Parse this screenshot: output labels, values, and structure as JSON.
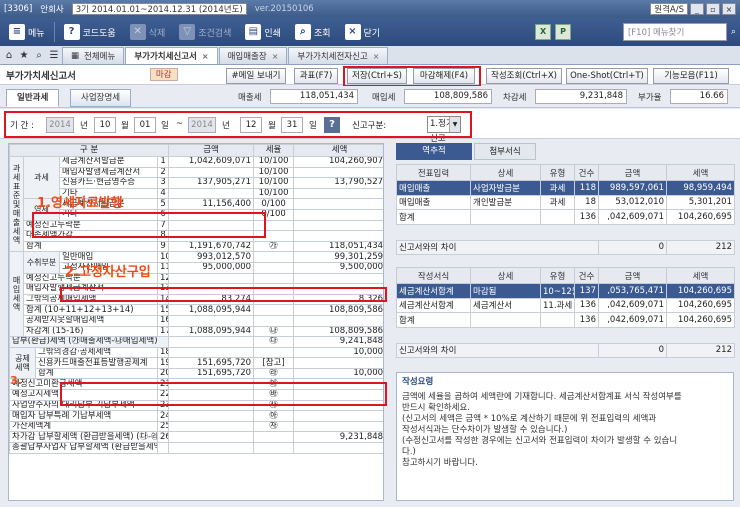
{
  "titlebar": {
    "code": "[3306]",
    "company": "안회사",
    "period": "3기 2014.01.01~2014.12.31 (2014년도)",
    "version": "ver.20150106",
    "service": "원격A/S"
  },
  "toolbar": {
    "menu": "메뉴",
    "codehelp": "코드도움",
    "delete": "삭제",
    "condsearch": "조건검색",
    "print": "인쇄",
    "search": "조회",
    "close": "닫기",
    "search_placeholder": "[F10] 메뉴찾기",
    "excel": "X",
    "pdf": "P"
  },
  "tabs": [
    "전체메뉴",
    "부가가치세신고서",
    "매입매출장",
    "부가가치세전자신고"
  ],
  "header": {
    "title": "부가가치세신고서",
    "status": "마감",
    "btn_email": "#메일 보내기",
    "btn_tax": "과표(F7)",
    "btn_save": "저장(Ctrl+S)",
    "btn_unclose": "마감해제(F4)",
    "btn_create": "작성조회(Ctrl+X)",
    "btn_oneshot": "One-Shot(Ctrl+T)",
    "btn_func": "기능모음(F11)"
  },
  "subtabs": [
    "일반과세",
    "사업장명세"
  ],
  "summary": {
    "sales_label": "매출세",
    "sales": "118,051,434",
    "purchase_label": "매입세",
    "purchase": "108,809,586",
    "payable_label": "차감세",
    "payable": "9,231,848",
    "rate_label": "부가율",
    "rate": "16.66"
  },
  "period": {
    "label": "기 간 :",
    "from_year": "2014",
    "y": "년",
    "from_month": "10",
    "m": "월",
    "from_day": "01",
    "d": "일",
    "tilde": "~",
    "to_year": "2014",
    "to_month": "12",
    "to_day": "31",
    "type_label": "신고구분:",
    "type_value": "1.정기신고"
  },
  "left": {
    "hdr_item": "구 분",
    "hdr_amount": "금액",
    "hdr_rate": "세율",
    "hdr_tax": "세액",
    "sec_sales": "과세표준및매출세액",
    "sec_purchase": "매입세액",
    "sec_pay": "납부(환급)세액",
    "sec_deduct": "공제세액",
    "g_tax": "과세",
    "g_zero": "영세",
    "g_purch": "수취부분",
    "rows": [
      {
        "label": "세금계산서발급분",
        "no": "1",
        "amount": "1,042,609,071",
        "rate": "10/100",
        "tax": "104,260,907"
      },
      {
        "label": "매입자발행세금계산서",
        "no": "2",
        "amount": "",
        "rate": "10/100",
        "tax": ""
      },
      {
        "label": "신용카드·현금영수증",
        "no": "3",
        "amount": "137,905,271",
        "rate": "10/100",
        "tax": "13,790,527"
      },
      {
        "label": "기타",
        "no": "4",
        "amount": "",
        "rate": "10/100",
        "tax": ""
      },
      {
        "label": "세금계산서발급분",
        "no": "5",
        "amount": "11,156,400",
        "rate": "0/100",
        "tax": ""
      },
      {
        "label": "기타",
        "no": "6",
        "amount": "",
        "rate": "0/100",
        "tax": ""
      },
      {
        "label": "예정신고누락분",
        "no": "7",
        "amount": "",
        "rate": "",
        "tax": ""
      },
      {
        "label": "대손세액가감",
        "no": "8",
        "amount": "",
        "rate": "",
        "tax": ""
      },
      {
        "label": "합계",
        "no": "9",
        "amount": "1,191,670,742",
        "rate": "㉮",
        "tax": "118,051,434"
      },
      {
        "label": "일반매입",
        "no": "10",
        "amount": "993,012,570",
        "rate": "",
        "tax": "99,301,259"
      },
      {
        "label": "고정자산매입",
        "no": "11",
        "amount": "95,000,000",
        "rate": "",
        "tax": "9,500,000"
      },
      {
        "label": "예정신고누락분",
        "no": "12",
        "amount": "",
        "rate": "",
        "tax": ""
      },
      {
        "label": "매입자발행세금계산서",
        "no": "13",
        "amount": "",
        "rate": "",
        "tax": ""
      },
      {
        "label": "그밖의공제매입세액",
        "no": "14",
        "amount": "83,274",
        "rate": "",
        "tax": "8,326"
      },
      {
        "label": "합계 (10+11+12+13+14)",
        "no": "15",
        "amount": "1,088,095,944",
        "rate": "",
        "tax": "108,809,586"
      },
      {
        "label": "공제받지못할매입세액",
        "no": "16",
        "amount": "",
        "rate": "",
        "tax": ""
      },
      {
        "label": "차감계 (15-16)",
        "no": "17",
        "amount": "1,088,095,944",
        "rate": "㉯",
        "tax": "108,809,586"
      },
      {
        "label": "납부(환급)세액 (㉮매출세액-㉯매입세액)",
        "no": "",
        "amount": "",
        "rate": "㉰",
        "tax": "9,241,848"
      },
      {
        "label": "그밖의경감·공제세액",
        "no": "18",
        "amount": "",
        "rate": "",
        "tax": "10,000"
      },
      {
        "label": "신용카드매출전표등발행공제계",
        "no": "19",
        "amount": "151,695,720",
        "rate": "[참고]",
        "tax": ""
      },
      {
        "label": "합계",
        "no": "20",
        "amount": "151,695,720",
        "rate": "㉱",
        "tax": "10,000"
      },
      {
        "label": "예정신고미환급세액",
        "no": "21",
        "amount": "",
        "rate": "㉲",
        "tax": ""
      },
      {
        "label": "예정고지세액",
        "no": "22",
        "amount": "",
        "rate": "㉳",
        "tax": ""
      },
      {
        "label": "사업양수자의 대리납부 기납부세액",
        "no": "23",
        "amount": "",
        "rate": "㉴",
        "tax": ""
      },
      {
        "label": "매입자 납부특례 기납부세액",
        "no": "24",
        "amount": "",
        "rate": "㉵",
        "tax": ""
      },
      {
        "label": "가산세액계",
        "no": "25",
        "amount": "",
        "rate": "㉶",
        "tax": ""
      },
      {
        "label": "차가감 납부할세액 (환급받을세액) (㉰-㉱-㉲-㉳-㉴-㉵+㉶)",
        "no": "26",
        "amount": "",
        "rate": "",
        "tax": "9,231,848"
      },
      {
        "label": "총괄납부사업자 납부할세액 (환급받을세액)",
        "no": "",
        "amount": "",
        "rate": "",
        "tax": ""
      }
    ],
    "anno1": "1.영세자료발행",
    "anno2": "2.고정자산구입",
    "anno3": "3."
  },
  "right": {
    "tab_active": "역추적",
    "tab_other": "첨부서식",
    "t1_headers": [
      "전표입력",
      "상세",
      "유형",
      "건수",
      "금액",
      "세액"
    ],
    "t1_rows": [
      {
        "c0": "매입매출",
        "c1": "사업자발급분",
        "c2": "과세",
        "c3": "118",
        "c4": "989,597,061",
        "c5": "98,959,494"
      },
      {
        "c0": "매입매출",
        "c1": "개인발급분",
        "c2": "과세",
        "c3": "18",
        "c4": "53,012,010",
        "c5": "5,301,201"
      },
      {
        "c0": "합계",
        "c1": "",
        "c2": "",
        "c3": "136",
        "c4": ",042,609,071",
        "c5": "104,260,695"
      }
    ],
    "t1_diff_label": "신고서와의 차이",
    "t1_diff_amount": "0",
    "t1_diff_tax": "212",
    "t2_headers": [
      "작성서식",
      "상세",
      "유형",
      "건수",
      "금액",
      "세액"
    ],
    "t2_rows": [
      {
        "c0": "세금계산서합계",
        "c1": "마감됨",
        "c2": "10~12월",
        "c3": "137",
        "c4": ",053,765,471",
        "c5": "104,260,695"
      },
      {
        "c0": "세금계산서합계",
        "c1": "세금계산서",
        "c2": "11.과세",
        "c3": "136",
        "c4": ",042,609,071",
        "c5": "104,260,695"
      },
      {
        "c0": "합계",
        "c1": "",
        "c2": "",
        "c3": "136",
        "c4": ",042,609,071",
        "c5": "104,260,695"
      }
    ],
    "t2_diff_label": "신고서와의 차이",
    "t2_diff_amount": "0",
    "t2_diff_tax": "212",
    "note_title": "작성요령",
    "note_lines": [
      "금액에 세율을 곱하여 세액란에 기재합니다. 세금계산서합계표 서식 작성여부를",
      "반드시 확인하세요.",
      "(신고서의 세액은 금액 * 10%로 계산하기 때문에 위 전표입력의 세액과",
      "작성서식과는 단수차이가 발생할 수 있습니다.)",
      "(수정신고서를 작성한 경우에는 신고서와 전표입력이 차이가 발생할 수 있습니",
      "다.)",
      "참고하시기 바랍니다."
    ]
  }
}
